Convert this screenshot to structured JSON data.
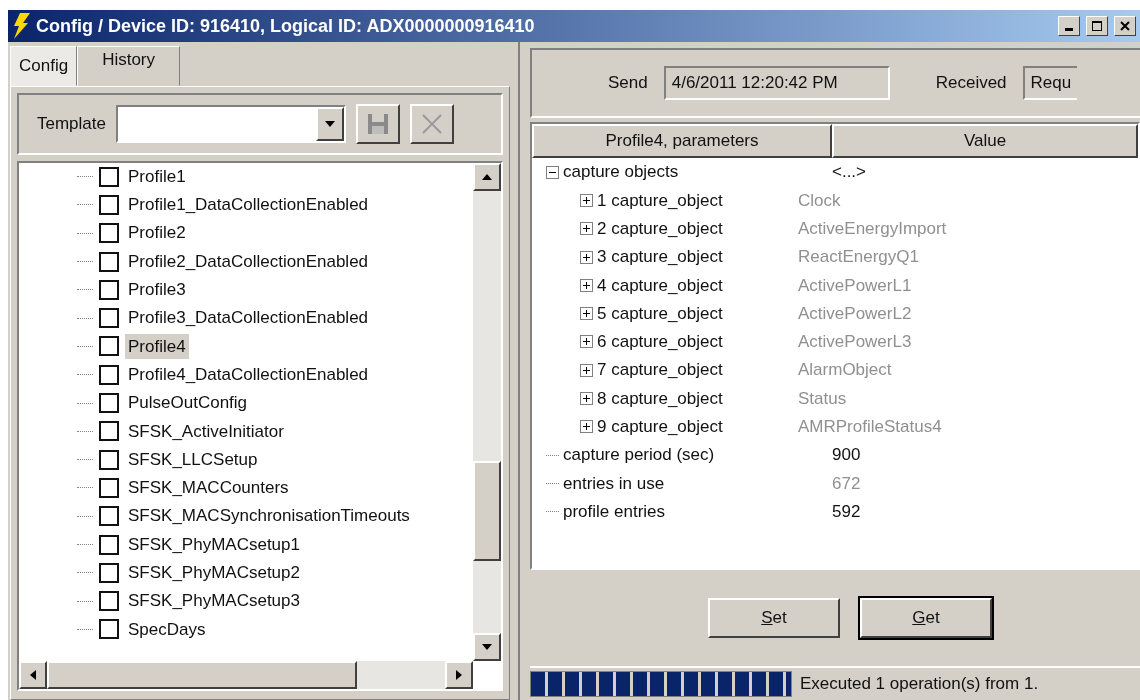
{
  "window": {
    "title": "Config / Device ID: 916410, Logical ID: ADX0000000916410"
  },
  "tabs": [
    {
      "label": "Config",
      "selected": true
    },
    {
      "label": "History",
      "selected": false
    }
  ],
  "template": {
    "label": "Template"
  },
  "tree": [
    {
      "label": "Profile1",
      "checked": false,
      "selected": false
    },
    {
      "label": "Profile1_DataCollectionEnabled",
      "checked": false,
      "selected": false
    },
    {
      "label": "Profile2",
      "checked": false,
      "selected": false
    },
    {
      "label": "Profile2_DataCollectionEnabled",
      "checked": false,
      "selected": false
    },
    {
      "label": "Profile3",
      "checked": false,
      "selected": false
    },
    {
      "label": "Profile3_DataCollectionEnabled",
      "checked": false,
      "selected": false
    },
    {
      "label": "Profile4",
      "checked": false,
      "selected": true
    },
    {
      "label": "Profile4_DataCollectionEnabled",
      "checked": false,
      "selected": false
    },
    {
      "label": "PulseOutConfig",
      "checked": false,
      "selected": false
    },
    {
      "label": "SFSK_ActiveInitiator",
      "checked": false,
      "selected": false
    },
    {
      "label": "SFSK_LLCSetup",
      "checked": false,
      "selected": false
    },
    {
      "label": "SFSK_MACCounters",
      "checked": false,
      "selected": false
    },
    {
      "label": "SFSK_MACSynchronisationTimeouts",
      "checked": false,
      "selected": false
    },
    {
      "label": "SFSK_PhyMACsetup1",
      "checked": false,
      "selected": false
    },
    {
      "label": "SFSK_PhyMACsetup2",
      "checked": false,
      "selected": false
    },
    {
      "label": "SFSK_PhyMACsetup3",
      "checked": false,
      "selected": false
    },
    {
      "label": "SpecDays",
      "checked": false,
      "selected": false
    }
  ],
  "send": {
    "label": "Send",
    "value": "4/6/2011 12:20:42 PM"
  },
  "received": {
    "label": "Received",
    "value": "Requ"
  },
  "params": {
    "columns": [
      "Profile4, parameters",
      "Value"
    ],
    "rows": [
      {
        "name": "capture objects",
        "value": "<...>",
        "dimmed": false,
        "expanded": true,
        "children": [
          {
            "name": "1 capture_object",
            "value": "Clock",
            "dimmed": true,
            "expanded": false
          },
          {
            "name": "2 capture_object",
            "value": "ActiveEnergyImport",
            "dimmed": true,
            "expanded": false
          },
          {
            "name": "3 capture_object",
            "value": "ReactEnergyQ1",
            "dimmed": true,
            "expanded": false
          },
          {
            "name": "4 capture_object",
            "value": "ActivePowerL1",
            "dimmed": true,
            "expanded": false
          },
          {
            "name": "5 capture_object",
            "value": "ActivePowerL2",
            "dimmed": true,
            "expanded": false
          },
          {
            "name": "6 capture_object",
            "value": "ActivePowerL3",
            "dimmed": true,
            "expanded": false
          },
          {
            "name": "7 capture_object",
            "value": "AlarmObject",
            "dimmed": true,
            "expanded": false
          },
          {
            "name": "8 capture_object",
            "value": "Status",
            "dimmed": true,
            "expanded": false
          },
          {
            "name": "9 capture_object",
            "value": "AMRProfileStatus4",
            "dimmed": true,
            "expanded": false
          }
        ]
      },
      {
        "name": "capture period (sec)",
        "value": "900",
        "dimmed": false
      },
      {
        "name": "entries in use",
        "value": "672",
        "dimmed": true
      },
      {
        "name": "profile entries",
        "value": "592",
        "dimmed": false
      }
    ]
  },
  "buttons": [
    {
      "label": "Set",
      "mnemonic_underlined": true,
      "default": false
    },
    {
      "label": "Get",
      "mnemonic_underlined": true,
      "default": true
    }
  ],
  "progress": {
    "level": 1
  },
  "status": "Executed 1 operation(s) from 1."
}
